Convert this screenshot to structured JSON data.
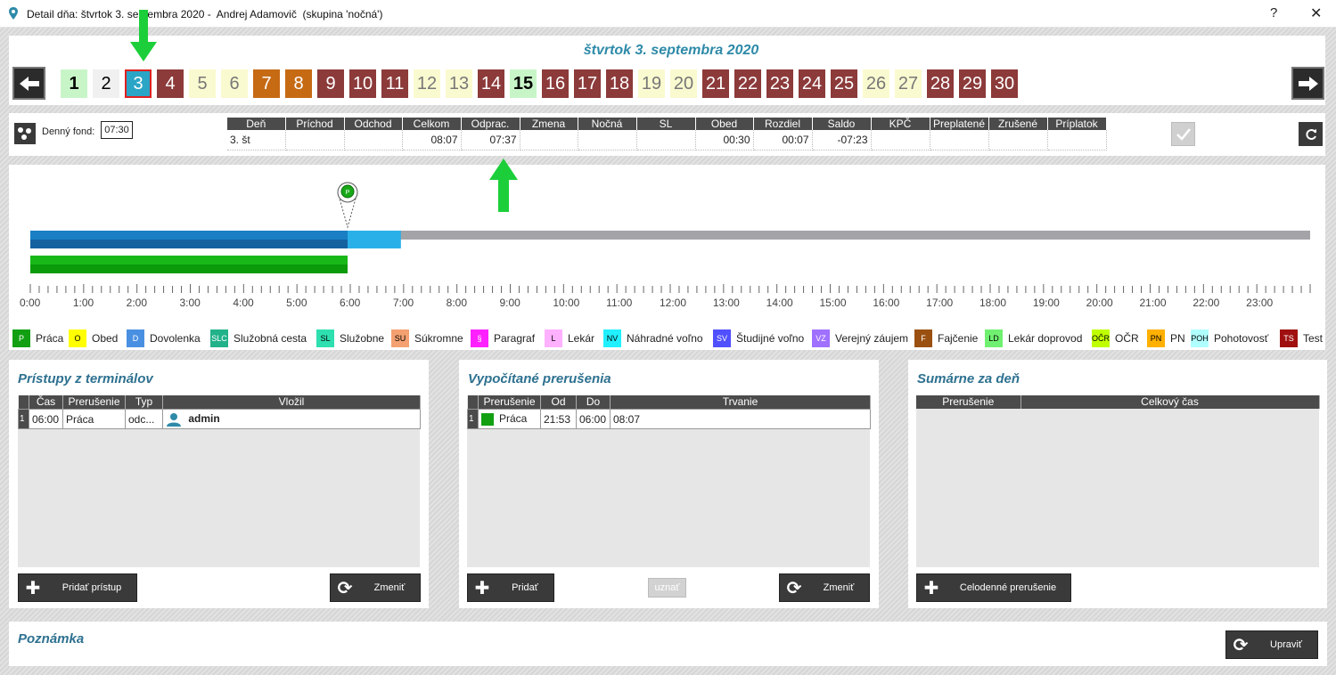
{
  "window": {
    "title": "Detail dňa: štvrtok 3. septembra 2020 -  Andrej Adamovič  (skupina 'nočná')",
    "help": "?",
    "close": "✕"
  },
  "day_header": {
    "title": "štvrtok 3. septembra 2020"
  },
  "days": [
    {
      "n": "1",
      "bg": "#c8f5c8",
      "fg": "#000",
      "bold": true
    },
    {
      "n": "2",
      "bg": "#f0f0f0",
      "fg": "#000",
      "bold": false
    },
    {
      "n": "3",
      "bg": "#2ba5c6",
      "fg": "#fff",
      "bold": false,
      "selected": true
    },
    {
      "n": "4",
      "bg": "#8c3a3a",
      "fg": "#fff",
      "bold": false
    },
    {
      "n": "5",
      "bg": "#fafad0",
      "fg": "#777",
      "bold": false
    },
    {
      "n": "6",
      "bg": "#fafad0",
      "fg": "#777",
      "bold": false
    },
    {
      "n": "7",
      "bg": "#c66a14",
      "fg": "#fff",
      "bold": false
    },
    {
      "n": "8",
      "bg": "#c66a14",
      "fg": "#fff",
      "bold": false
    },
    {
      "n": "9",
      "bg": "#8c3a3a",
      "fg": "#fff",
      "bold": false
    },
    {
      "n": "10",
      "bg": "#8c3a3a",
      "fg": "#fff",
      "bold": false
    },
    {
      "n": "11",
      "bg": "#8c3a3a",
      "fg": "#fff",
      "bold": false
    },
    {
      "n": "12",
      "bg": "#fafad0",
      "fg": "#777",
      "bold": false
    },
    {
      "n": "13",
      "bg": "#fafad0",
      "fg": "#777",
      "bold": false
    },
    {
      "n": "14",
      "bg": "#8c3a3a",
      "fg": "#fff",
      "bold": false
    },
    {
      "n": "15",
      "bg": "#c8f5c8",
      "fg": "#000",
      "bold": true
    },
    {
      "n": "16",
      "bg": "#8c3a3a",
      "fg": "#fff",
      "bold": false
    },
    {
      "n": "17",
      "bg": "#8c3a3a",
      "fg": "#fff",
      "bold": false
    },
    {
      "n": "18",
      "bg": "#8c3a3a",
      "fg": "#fff",
      "bold": false
    },
    {
      "n": "19",
      "bg": "#fafad0",
      "fg": "#777",
      "bold": false
    },
    {
      "n": "20",
      "bg": "#fafad0",
      "fg": "#777",
      "bold": false
    },
    {
      "n": "21",
      "bg": "#8c3a3a",
      "fg": "#fff",
      "bold": false
    },
    {
      "n": "22",
      "bg": "#8c3a3a",
      "fg": "#fff",
      "bold": false
    },
    {
      "n": "23",
      "bg": "#8c3a3a",
      "fg": "#fff",
      "bold": false
    },
    {
      "n": "24",
      "bg": "#8c3a3a",
      "fg": "#fff",
      "bold": false
    },
    {
      "n": "25",
      "bg": "#8c3a3a",
      "fg": "#fff",
      "bold": false
    },
    {
      "n": "26",
      "bg": "#fafad0",
      "fg": "#777",
      "bold": false
    },
    {
      "n": "27",
      "bg": "#fafad0",
      "fg": "#777",
      "bold": false
    },
    {
      "n": "28",
      "bg": "#8c3a3a",
      "fg": "#fff",
      "bold": false
    },
    {
      "n": "29",
      "bg": "#8c3a3a",
      "fg": "#fff",
      "bold": false
    },
    {
      "n": "30",
      "bg": "#8c3a3a",
      "fg": "#fff",
      "bold": false
    }
  ],
  "summary": {
    "fond_label": "Denný fond:",
    "fond_value": "07:30",
    "headers": [
      "Deň",
      "Príchod",
      "Odchod",
      "Celkom",
      "Odprac.",
      "Zmena",
      "Nočná",
      "SL",
      "Obed",
      "Rozdiel",
      "Saldo",
      "KPČ",
      "Preplatené",
      "Zrušené",
      "Príplatok"
    ],
    "row": [
      "3. št",
      "",
      "",
      "08:07",
      "07:37",
      "",
      "",
      "",
      "00:30",
      "00:07",
      "-07:23",
      "",
      "",
      "",
      ""
    ]
  },
  "timeline": {
    "hours": [
      "0:00",
      "1:00",
      "2:00",
      "3:00",
      "4:00",
      "5:00",
      "6:00",
      "7:00",
      "8:00",
      "9:00",
      "10:00",
      "11:00",
      "12:00",
      "13:00",
      "14:00",
      "15:00",
      "16:00",
      "17:00",
      "18:00",
      "19:00",
      "20:00",
      "21:00",
      "22:00",
      "23:00"
    ],
    "marker_letter": "P",
    "bars": {
      "shift_worked_until_h": 5.95,
      "shift_extra_until_h": 6.95,
      "presence_until_h": 5.95
    }
  },
  "legend": [
    {
      "code": "P",
      "label": "Práca",
      "color": "#12a012"
    },
    {
      "code": "O",
      "label": "Obed",
      "color": "#ffff00"
    },
    {
      "code": "D",
      "label": "Dovolenka",
      "color": "#4a90e2"
    },
    {
      "code": "SLC",
      "label": "Služobná cesta",
      "color": "#22b28a"
    },
    {
      "code": "SL",
      "label": "Služobne",
      "color": "#2ee0b0"
    },
    {
      "code": "SU",
      "label": "Súkromne",
      "color": "#f4a070"
    },
    {
      "code": "§",
      "label": "Paragraf",
      "color": "#ff20ff"
    },
    {
      "code": "L",
      "label": "Lekár",
      "color": "#ffb0ff"
    },
    {
      "code": "NV",
      "label": "Náhradné voľno",
      "color": "#20f0ff"
    },
    {
      "code": "SV",
      "label": "Študijné voľno",
      "color": "#5050ff"
    },
    {
      "code": "VZ",
      "label": "Verejný záujem",
      "color": "#a070ff"
    },
    {
      "code": "F",
      "label": "Fajčenie",
      "color": "#9a5010"
    },
    {
      "code": "LD",
      "label": "Lekár doprovod",
      "color": "#70f070"
    },
    {
      "code": "OČR",
      "label": "OČR",
      "color": "#c0ff00"
    },
    {
      "code": "PN",
      "label": "PN",
      "color": "#ffb000"
    },
    {
      "code": "POH",
      "label": "Pohotovosť",
      "color": "#b0ffff"
    },
    {
      "code": "TS",
      "label": "Test",
      "color": "#a01010"
    }
  ],
  "access": {
    "title": "Prístupy z terminálov",
    "headers": [
      "Čas",
      "Prerušenie",
      "Typ",
      "Vložil"
    ],
    "rows": [
      {
        "num": "1",
        "time": "06:00",
        "type": "Práca",
        "kind": "odc...",
        "user": "admin"
      }
    ],
    "add_label": "Pridať prístup",
    "change_label": "Zmeniť"
  },
  "computed": {
    "title": "Vypočítané prerušenia",
    "headers": [
      "Prerušenie",
      "Od",
      "Do",
      "Trvanie"
    ],
    "rows": [
      {
        "num": "1",
        "name": "Práca",
        "from": "21:53",
        "to": "06:00",
        "dur": "08:07",
        "color": "#12a012"
      }
    ],
    "add_label": "Pridať",
    "accept_label": "uznať",
    "change_label": "Zmeniť"
  },
  "daysum": {
    "title": "Sumárne za deň",
    "headers": [
      "Prerušenie",
      "Celkový čas"
    ],
    "add_label": "Celodenné prerušenie"
  },
  "note": {
    "title": "Poznámka",
    "edit_label": "Upraviť"
  }
}
